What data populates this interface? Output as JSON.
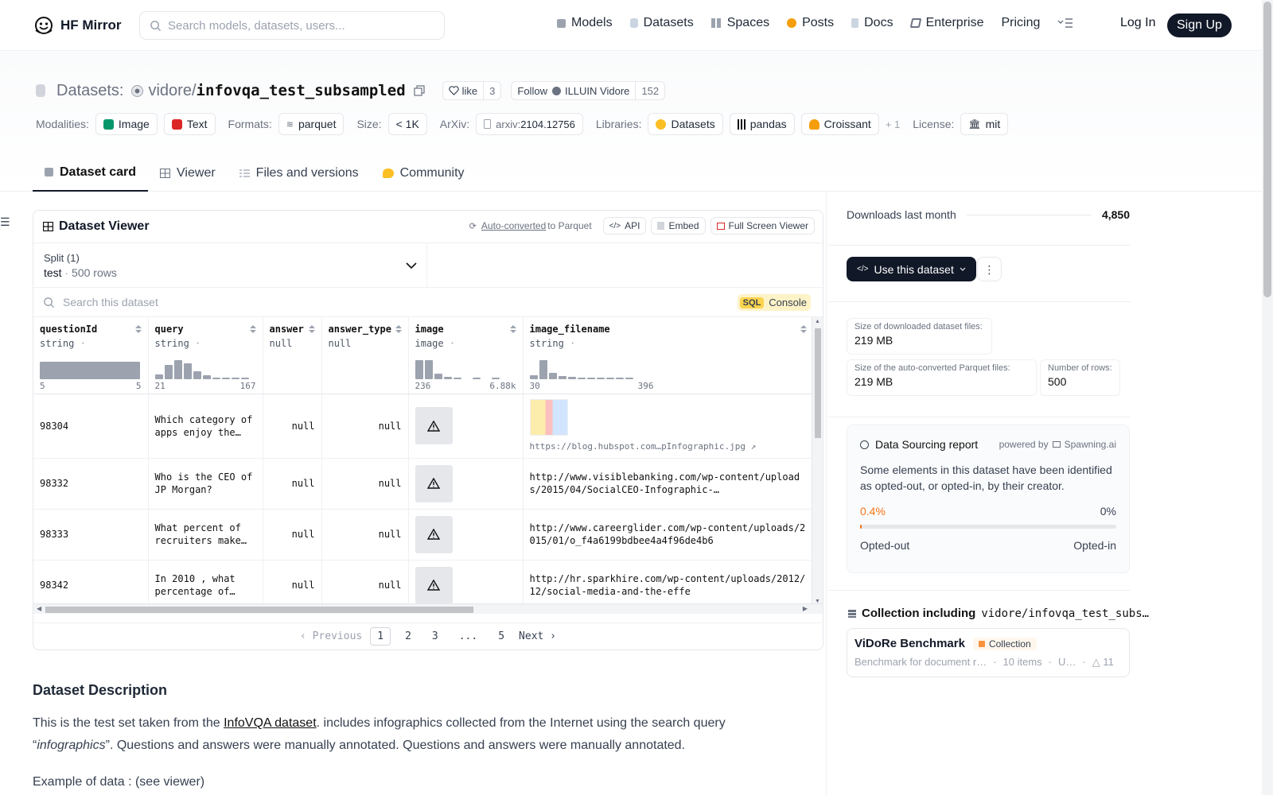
{
  "nav": {
    "brand": "HF Mirror",
    "search_placeholder": "Search models, datasets, users...",
    "links": [
      "Models",
      "Datasets",
      "Spaces",
      "Posts",
      "Docs",
      "Enterprise",
      "Pricing"
    ],
    "login": "Log In",
    "signup": "Sign Up"
  },
  "header": {
    "section": "Datasets:",
    "owner": "vidore",
    "slash": "/",
    "name": "infovqa_test_subsampled",
    "like_label": "like",
    "like_count": "3",
    "follow_label": "Follow",
    "org_name": "ILLUIN Vidore",
    "follow_count": "152",
    "modalities_label": "Modalities:",
    "modalities": [
      "Image",
      "Text"
    ],
    "formats_label": "Formats:",
    "format": "parquet",
    "size_label": "Size:",
    "size": "< 1K",
    "arxiv_label": "ArXiv:",
    "arxiv_prefix": "arxiv:",
    "arxiv_id": "2104.12756",
    "libraries_label": "Libraries:",
    "libraries": [
      "Datasets",
      "pandas",
      "Croissant"
    ],
    "libraries_more": "+ 1",
    "license_label": "License:",
    "license": "mit"
  },
  "tabs": [
    "Dataset card",
    "Viewer",
    "Files and versions",
    "Community"
  ],
  "viewer": {
    "title": "Dataset Viewer",
    "auto_converted": "Auto-converted",
    "to_parquet": "to Parquet",
    "api": "API",
    "embed": "Embed",
    "fullscreen": "Full Screen Viewer",
    "split_label": "Split (1)",
    "split_name": "test",
    "split_rows": "500 rows",
    "search_placeholder": "Search this dataset",
    "sql": "SQL",
    "console": "Console",
    "columns": [
      {
        "name": "questionId",
        "type": "string",
        "stat": "lengths",
        "min": "5",
        "max": "5"
      },
      {
        "name": "query",
        "type": "string",
        "stat": "lengths",
        "min": "21",
        "max": "167"
      },
      {
        "name": "answer",
        "type": "null",
        "stat": "",
        "min": "",
        "max": ""
      },
      {
        "name": "answer_type",
        "type": "null",
        "stat": "",
        "min": "",
        "max": ""
      },
      {
        "name": "image",
        "type": "image",
        "stat": "width (px)",
        "min": "236",
        "max": "6.88k"
      },
      {
        "name": "image_filename",
        "type": "string",
        "stat": "lengths",
        "min": "30",
        "max": "396"
      }
    ],
    "rows": [
      {
        "questionId": "98304",
        "query": "Which category of apps enjoy the…",
        "answer": "null",
        "answer_type": "null",
        "image_filename": "https://blog.hubspot.com…pInfographic.jpg"
      },
      {
        "questionId": "98332",
        "query": "Who is the CEO of JP Morgan?",
        "answer": "null",
        "answer_type": "null",
        "image_filename": "http://www.visiblebanking.com/wp-content/uploads/2015/04/SocialCEO-Infographic-…"
      },
      {
        "questionId": "98333",
        "query": "What percent of recruiters make…",
        "answer": "null",
        "answer_type": "null",
        "image_filename": "http://www.careerglider.com/wp-content/uploads/2015/01/o_f4a6199bdbee4a4f96de4b6"
      },
      {
        "questionId": "98342",
        "query": "In 2010 , what percentage of…",
        "answer": "null",
        "answer_type": "null",
        "image_filename": "http://hr.sparkhire.com/wp-content/uploads/2012/12/social-media-and-the-effe"
      }
    ],
    "pager": {
      "prev": "Previous",
      "pages": [
        "1",
        "2",
        "3",
        "...",
        "5"
      ],
      "next": "Next",
      "current": "1"
    }
  },
  "description": {
    "heading": "Dataset Description",
    "text_before": "This is the test set taken from the ",
    "link": "InfoVQA dataset",
    "text_after": ". includes infographics collected from the Internet using the search query “",
    "italic": "infographics",
    "text_end": "”. Questions and answers were manually annotated. Questions and answers were manually annotated.",
    "example": "Example of data : (see viewer)"
  },
  "sidebar": {
    "downloads_label": "Downloads last month",
    "downloads_value": "4,850",
    "use_button": "Use this dataset",
    "stats": [
      {
        "label": "Size of downloaded dataset files:",
        "value": "219 MB"
      },
      {
        "label": "Size of the auto-converted Parquet files:",
        "value": "219 MB"
      },
      {
        "label": "Number of rows:",
        "value": "500"
      }
    ],
    "report_title": "Data Sourcing report",
    "powered_by": "powered by",
    "spawning": "Spawning.ai",
    "report_text": "Some elements in this dataset have been identified as opted-out, or opted-in, by their creator.",
    "opted_out_pct": "0.4%",
    "opted_in_pct": "0%",
    "opted_out_fraction": 0.004,
    "opted_out_label": "Opted-out",
    "opted_in_label": "Opted-in",
    "collection_heading": "Collection including",
    "collection_ref": "vidore/infovqa_test_subs…",
    "collection_name": "ViDoRe Benchmark",
    "collection_badge": "Collection",
    "collection_desc": "Benchmark for document r…",
    "collection_items": "10 items",
    "collection_updated": "U…",
    "collection_likes": "11"
  }
}
